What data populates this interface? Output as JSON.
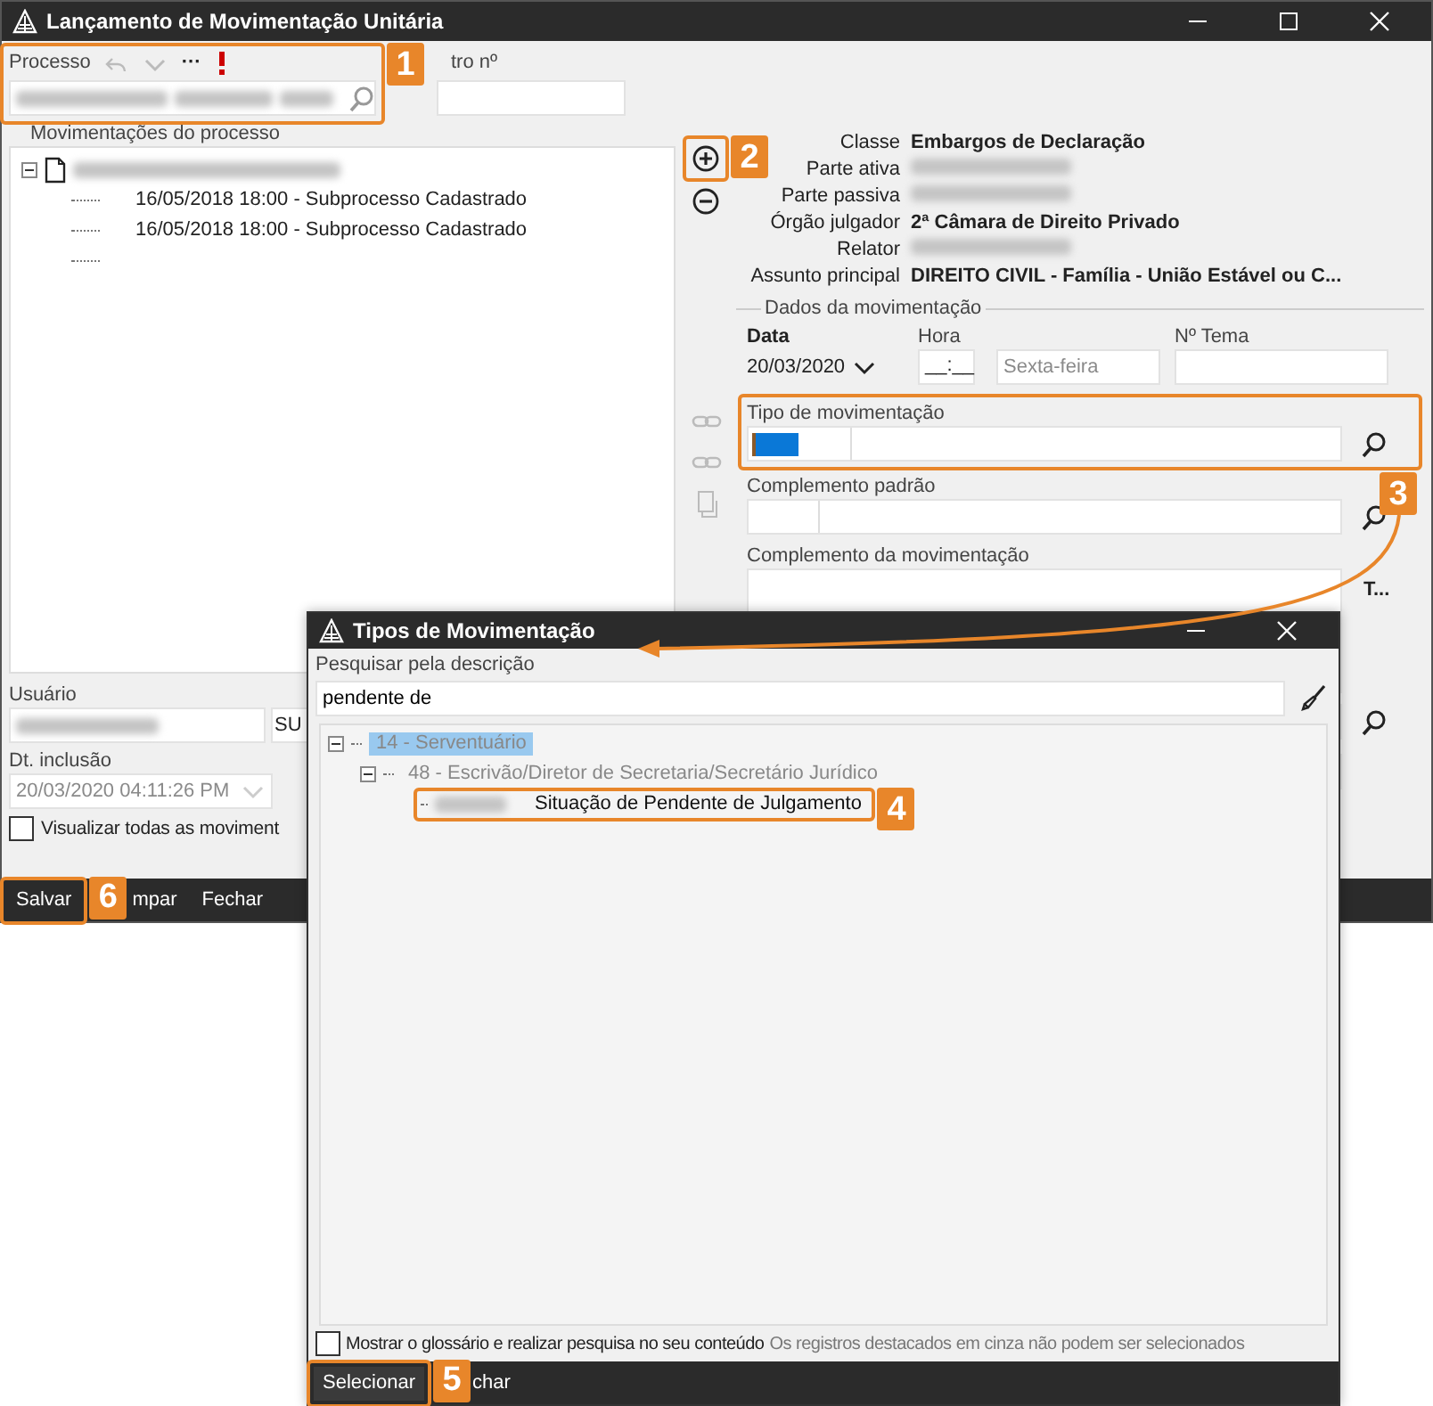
{
  "window": {
    "title": "Lançamento de Movimentação Unitária"
  },
  "process": {
    "label": "Processo",
    "more": "···"
  },
  "other_number": {
    "label": "tro nº"
  },
  "movements": {
    "title": "Movimentações do processo",
    "expanded": true,
    "children": [
      {
        "label": "16/05/2018 18:00 - Subprocesso Cadastrado"
      },
      {
        "label": "16/05/2018 18:00 - Subprocesso Cadastrado"
      }
    ]
  },
  "details": [
    {
      "label": "Classe",
      "value": "Embargos de Declaração"
    },
    {
      "label": "Parte ativa"
    },
    {
      "label": "Parte passiva"
    },
    {
      "label": "Órgão julgador",
      "value": "2ª Câmara de Direito Privado"
    },
    {
      "label": "Relator"
    },
    {
      "label": "Assunto principal",
      "value": "DIREITO CIVIL - Família - União Estável ou C..."
    }
  ],
  "movement_data": {
    "title": "Dados da movimentação",
    "date": {
      "label": "Data",
      "value": "20/03/2020"
    },
    "time": {
      "label": "Hora",
      "value": "__:__"
    },
    "weekday": {
      "value": "Sexta-feira",
      "disabled": true
    },
    "theme": {
      "label": "Nº Tema"
    },
    "type": {
      "label": "Tipo de movimentação"
    },
    "complement_default": {
      "label": "Complemento padrão"
    },
    "complement": {
      "label": "Complemento da movimentação",
      "tool": "T..."
    }
  },
  "user": {
    "label": "Usuário",
    "code": "SU"
  },
  "inclusion": {
    "label": "Dt. inclusão",
    "value": "20/03/2020 04:11:26 PM",
    "disabled": true
  },
  "show_all": {
    "label": "Visualizar todas as moviment",
    "checked": false
  },
  "toolbar": [
    {
      "label": "Salvar"
    },
    {
      "label": "mpar"
    },
    {
      "label": "Fechar"
    }
  ],
  "dialog": {
    "title": "Tipos de Movimentação",
    "search": {
      "label": "Pesquisar pela descrição",
      "value": "pendente de"
    },
    "tree": [
      {
        "label": "14 - Serventuário",
        "selected": true,
        "disabled": true,
        "expanded": true,
        "children": [
          {
            "label": "48 - Escrivão/Diretor de Secretaria/Secretário Jurídico",
            "selected": false,
            "disabled": true,
            "expanded": true,
            "children": [
              {
                "label": "Situação de Pendente de Julgamento",
                "selected": false,
                "disabled": false
              }
            ]
          }
        ]
      }
    ],
    "glossary": {
      "label": "Mostrar o glossário e realizar pesquisa no seu conteúdo",
      "checked": false
    },
    "note": "Os registros destacados em cinza não podem ser selecionados",
    "buttons": [
      {
        "label": "Selecionar"
      },
      {
        "label": "char"
      }
    ]
  },
  "callouts": [
    {
      "number": "1"
    },
    {
      "number": "2"
    },
    {
      "number": "3"
    },
    {
      "number": "4"
    },
    {
      "number": "5"
    },
    {
      "number": "6"
    }
  ]
}
